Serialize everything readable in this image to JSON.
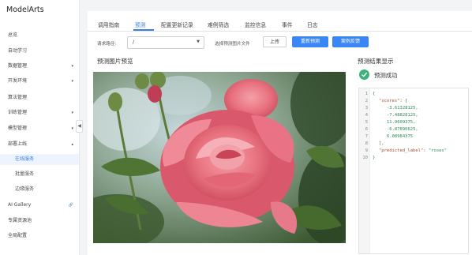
{
  "app": {
    "brand": "ModelArts"
  },
  "sidebar": {
    "items": [
      {
        "label": "总览"
      },
      {
        "label": "自动学习"
      },
      {
        "label": "数据管理",
        "caret": "▾"
      },
      {
        "label": "开发环境",
        "caret": "▾"
      },
      {
        "label": "算法管理"
      },
      {
        "label": "训练管理",
        "caret": "▾"
      },
      {
        "label": "模型管理",
        "caret": "▾"
      },
      {
        "label": "部署上线",
        "caret": "▴"
      },
      {
        "label": "在线服务"
      },
      {
        "label": "批量服务"
      },
      {
        "label": "边缘服务"
      },
      {
        "label": "AI Gallery",
        "caret": "🔗"
      },
      {
        "label": "专属资源池"
      },
      {
        "label": "全局配置"
      }
    ],
    "collapse_glyph": "◀"
  },
  "tabs": [
    {
      "label": "调用指南"
    },
    {
      "label": "预测"
    },
    {
      "label": "配置更新记录"
    },
    {
      "label": "难例筛选"
    },
    {
      "label": "监控信息"
    },
    {
      "label": "事件"
    },
    {
      "label": "日志"
    }
  ],
  "toolbar": {
    "path_label": "请求路径:",
    "path_value": "/",
    "file_label": "选择预测图片文件",
    "upload_button": "上传",
    "repredict_button": "重新预测",
    "feedback_button": "案例反馈"
  },
  "preview": {
    "title": "预测图片预览"
  },
  "result": {
    "title": "预测结果显示",
    "status": "预测成功",
    "lines": [
      {
        "n": "1",
        "t": "{"
      },
      {
        "n": "2",
        "key": "\"scores\"",
        "rest": ": ["
      },
      {
        "n": "3",
        "num": "-3.61328125,"
      },
      {
        "n": "4",
        "num": "-7.48828125,"
      },
      {
        "n": "5",
        "num": "11.9609375,"
      },
      {
        "n": "6",
        "num": "-6.87890625,"
      },
      {
        "n": "7",
        "num": "6.08984375"
      },
      {
        "n": "8",
        "t": "],"
      },
      {
        "n": "9",
        "key": "\"predicted_label\"",
        "rest": ": ",
        "str": "\"roses\""
      },
      {
        "n": "10",
        "t": "}"
      }
    ]
  },
  "colors": {
    "accent": "#3b86f5",
    "success": "#3bb27a"
  }
}
